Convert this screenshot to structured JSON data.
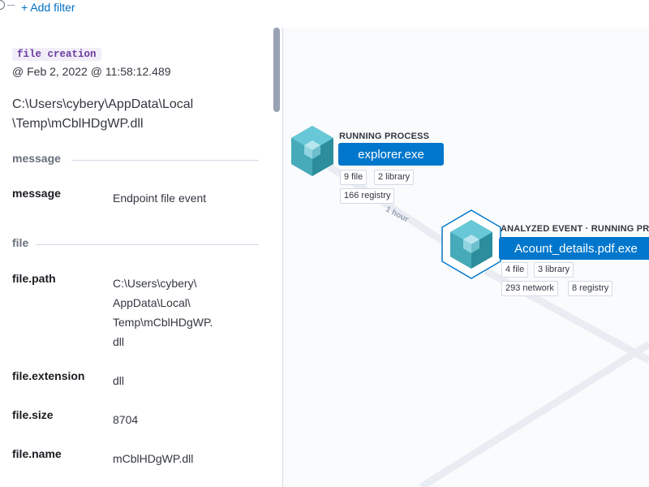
{
  "filter_bar": {
    "add_filter": "+ Add filter"
  },
  "detail": {
    "event_badge": "file creation",
    "timestamp": "@ Feb 2, 2022 @ 11:58:12.489",
    "path_line1": "C:\\Users\\cybery\\AppData\\Local",
    "path_line2": "\\Temp\\mCblHDgWP.dll",
    "sections": {
      "message": "message",
      "file": "file"
    },
    "fields": {
      "message": {
        "key": "message",
        "value": "Endpoint file event"
      },
      "file_path": {
        "key": "file.path",
        "value_lines": [
          "C:\\Users\\cybery\\",
          "AppData\\Local\\",
          "Temp\\mCblHDgWP.",
          "dll"
        ]
      },
      "file_extension": {
        "key": "file.extension",
        "value": "dll"
      },
      "file_size": {
        "key": "file.size",
        "value": "8704"
      },
      "file_name": {
        "key": "file.name",
        "value": "mCblHDgWP.dll"
      }
    }
  },
  "graph": {
    "edge_label": "1 hour",
    "nodes": [
      {
        "title": "RUNNING PROCESS",
        "name": "explorer.exe",
        "chips": [
          "9 file",
          "2 library",
          "166 registry"
        ]
      },
      {
        "title": "ANALYZED EVENT · RUNNING PROC",
        "name": "Acount_details.pdf.exe",
        "chips": [
          "4 file",
          "3 library",
          "293 network",
          "8 registry"
        ]
      }
    ],
    "colors": {
      "accent": "#0077cc",
      "cube_top": "#5fc5d6",
      "cube_side": "#2a8a9a"
    }
  }
}
